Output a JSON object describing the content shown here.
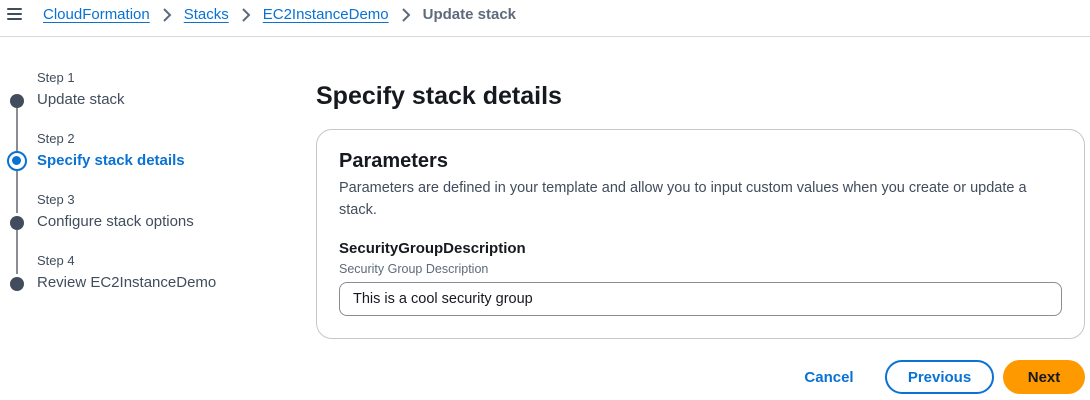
{
  "topbar": {
    "menu_icon": "menu-icon",
    "breadcrumb": {
      "links": [
        "CloudFormation",
        "Stacks",
        "EC2InstanceDemo"
      ],
      "current": "Update stack",
      "separator_icon": "chevron-right-icon"
    }
  },
  "steps": [
    {
      "number": "Step 1",
      "label": "Update stack",
      "state": "completed"
    },
    {
      "number": "Step 2",
      "label": "Specify stack details",
      "state": "active"
    },
    {
      "number": "Step 3",
      "label": "Configure stack options",
      "state": "pending"
    },
    {
      "number": "Step 4",
      "label": "Review EC2InstanceDemo",
      "state": "pending"
    }
  ],
  "main": {
    "title": "Specify stack details",
    "parameters": {
      "heading": "Parameters",
      "description": "Parameters are defined in your template and allow you to input custom values when you create or update a stack.",
      "fields": [
        {
          "label": "SecurityGroupDescription",
          "description": "Security Group Description",
          "value": "This is a cool security group"
        }
      ]
    }
  },
  "footer": {
    "cancel_label": "Cancel",
    "previous_label": "Previous",
    "next_label": "Next"
  },
  "colors": {
    "link": "#0972d3",
    "primary_button": "#ff9900",
    "text": "#16191f",
    "muted_text": "#414d5c",
    "border": "#c6c6cd"
  }
}
